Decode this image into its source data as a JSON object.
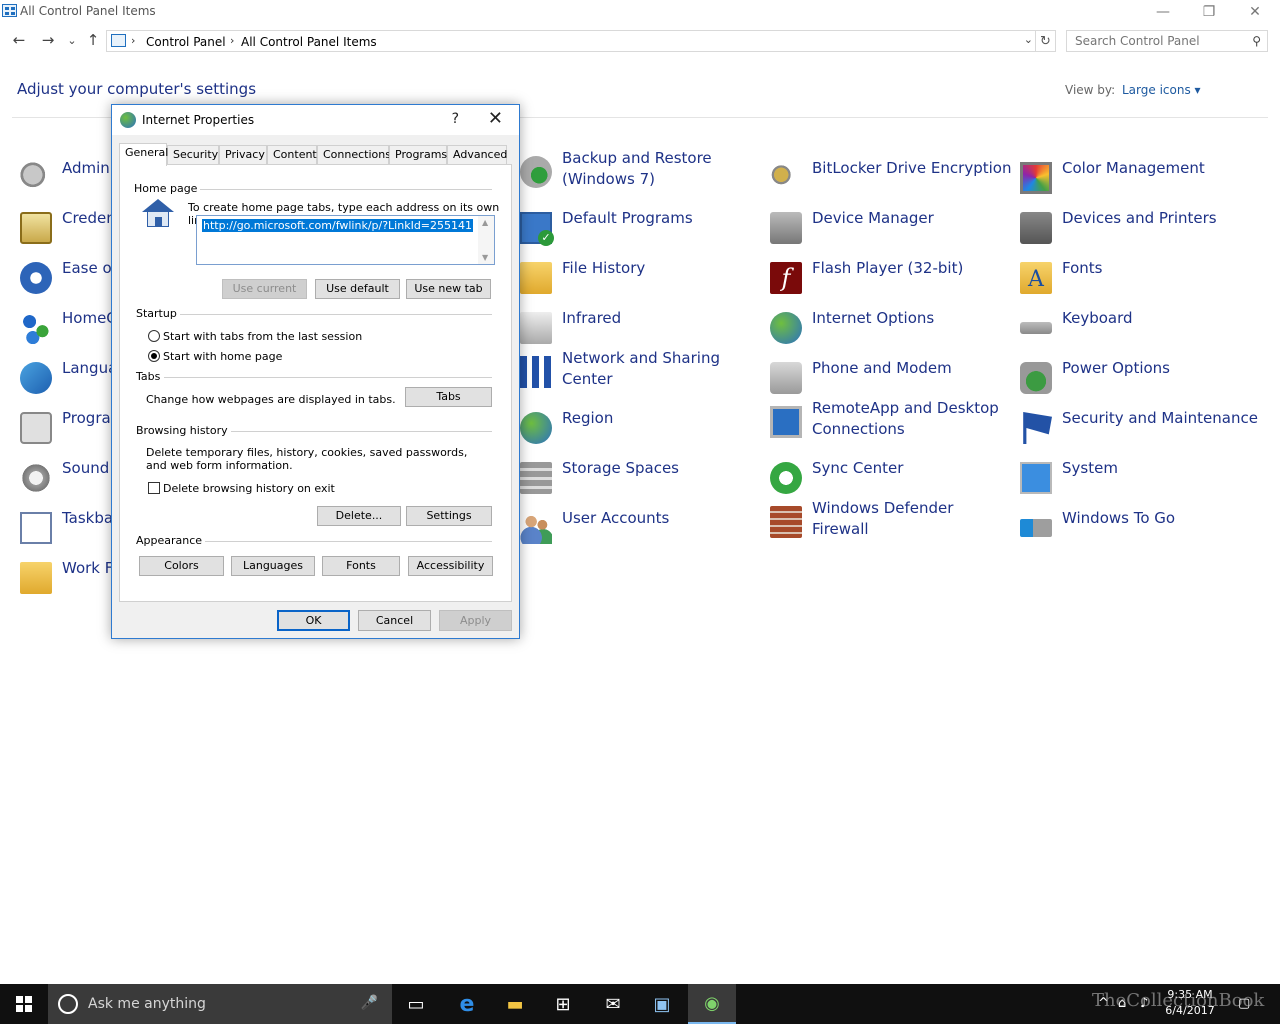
{
  "window": {
    "title": "All Control Panel Items",
    "minimize_glyph": "—",
    "restore_glyph": "❐",
    "close_glyph": "✕"
  },
  "nav": {
    "back_glyph": "←",
    "forward_glyph": "→",
    "recent_glyph": "⌄",
    "up_glyph": "↑"
  },
  "address": {
    "crumbs": [
      "Control Panel",
      "All Control Panel Items"
    ],
    "separator": "›",
    "dropdown_glyph": "⌄",
    "refresh_glyph": "↻"
  },
  "search": {
    "placeholder": "Search Control Panel",
    "icon_glyph": "⚲"
  },
  "heading": "Adjust your computer's settings",
  "view_by": {
    "label": "View by:",
    "value": "Large icons ▾"
  },
  "items": {
    "col1": [
      "Admini",
      "Creden",
      "Ease of",
      "HomeG",
      "Langua",
      "Progra",
      "Sound",
      "Taskbar",
      "Work F"
    ],
    "col2": [
      "Backup and Restore (Windows 7)",
      "Default Programs",
      "File History",
      "Infrared",
      "Network and Sharing Center",
      "Region",
      "Storage Spaces",
      "User Accounts"
    ],
    "col3": [
      "BitLocker Drive Encryption",
      "Device Manager",
      "Flash Player (32-bit)",
      "Internet Options",
      "Phone and Modem",
      "RemoteApp and Desktop Connections",
      "Sync Center",
      "Windows Defender Firewall"
    ],
    "col4": [
      "Color Management",
      "Devices and Printers",
      "Fonts",
      "Keyboard",
      "Power Options",
      "Security and Maintenance",
      "System",
      "Windows To Go"
    ]
  },
  "icon_glyphs": {
    "flash": "f",
    "fonts": "A"
  },
  "dialog": {
    "title": "Internet Properties",
    "help_glyph": "?",
    "close_glyph": "✕",
    "tabs": [
      "General",
      "Security",
      "Privacy",
      "Content",
      "Connections",
      "Programs",
      "Advanced"
    ],
    "home_page": {
      "label": "Home page",
      "instruction": "To create home page tabs, type each address on its own line.",
      "url": "http://go.microsoft.com/fwlink/p/?LinkId=255141",
      "scroll_up_glyph": "▲",
      "scroll_down_glyph": "▼",
      "use_current": "Use current",
      "use_default": "Use default",
      "use_new_tab": "Use new tab"
    },
    "startup": {
      "label": "Startup",
      "option_last_session": "Start with tabs from the last session",
      "option_home_page": "Start with home page"
    },
    "tabs_section": {
      "label": "Tabs",
      "description": "Change how webpages are displayed in tabs.",
      "button": "Tabs"
    },
    "browsing_history": {
      "label": "Browsing history",
      "description": "Delete temporary files, history, cookies, saved passwords, and web form information.",
      "checkbox": "Delete browsing history on exit",
      "delete_button": "Delete...",
      "settings_button": "Settings"
    },
    "appearance": {
      "label": "Appearance",
      "colors": "Colors",
      "languages": "Languages",
      "fonts": "Fonts",
      "accessibility": "Accessibility"
    },
    "ok": "OK",
    "cancel": "Cancel",
    "apply": "Apply"
  },
  "taskbar": {
    "cortana_text": "Ask me anything",
    "mic_glyph": "🎤",
    "taskview_glyph": "▭",
    "edge_glyph": "e",
    "explorer_glyph": "▬",
    "store_glyph": "⊞",
    "mail_glyph": "✉",
    "cpanel_glyph": "▣",
    "inet_glyph": "◉",
    "tray_glyphs": {
      "chevron": "^",
      "network": "⌂",
      "volume": "♪",
      "action_center": "▢"
    },
    "time": "9:35 AM",
    "date": "6/4/2017",
    "watermark": "TheCollectionBook"
  }
}
